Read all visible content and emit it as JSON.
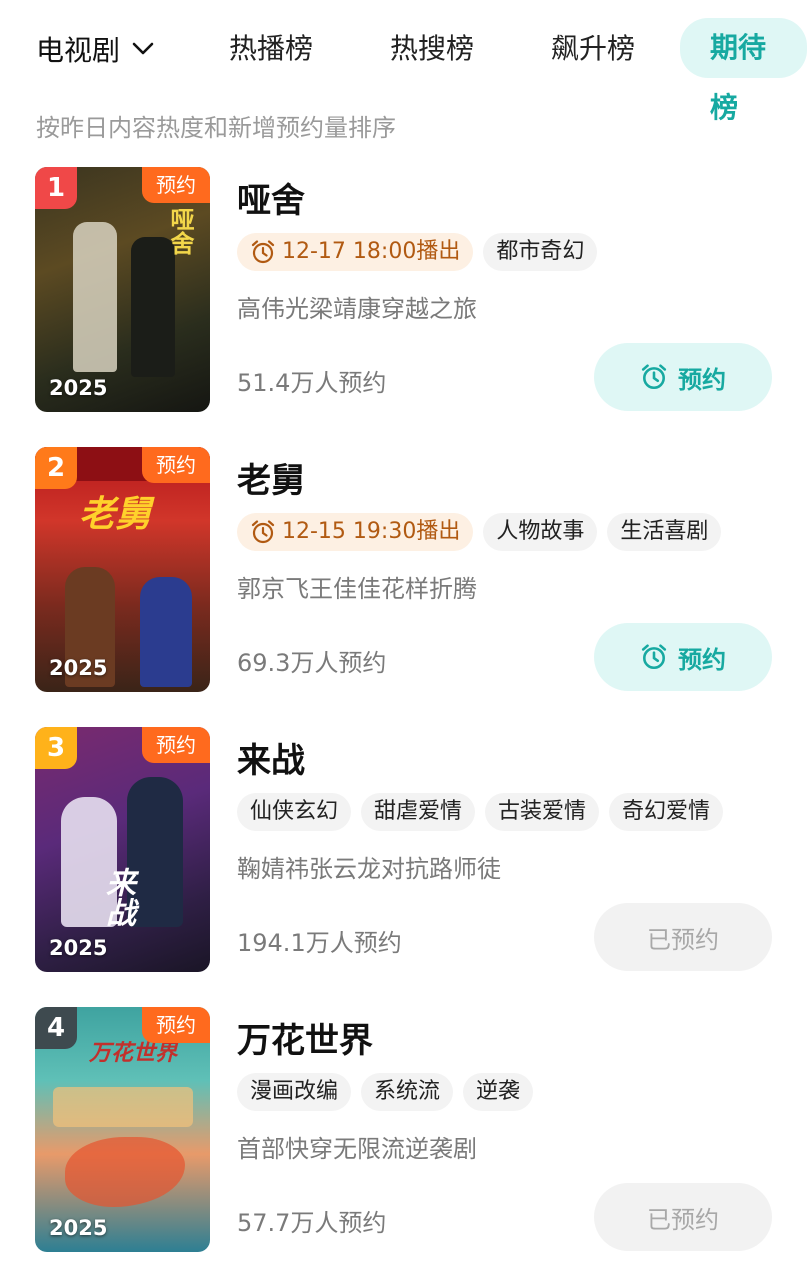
{
  "header": {
    "category": "电视剧",
    "tabs": [
      {
        "label": "热播榜"
      },
      {
        "label": "热搜榜"
      },
      {
        "label": "飙升榜"
      },
      {
        "label": "期待榜"
      }
    ],
    "subtitle": "按昨日内容热度和新增预约量排序"
  },
  "colors": {
    "accent": "#17a9a1",
    "badge": "#ff6a1e",
    "rank1": "#f04848",
    "rank2": "#ff7a1a",
    "rank3": "#ffb21a",
    "rank4": "#3e4a4f"
  },
  "items": [
    {
      "rank": "1",
      "badge": "预约",
      "year": "2025",
      "poster_text": "哑舍",
      "title": "哑舍",
      "air": "12-17 18:00播出",
      "tags": [
        "都市奇幻"
      ],
      "desc": "高伟光梁靖康穿越之旅",
      "count": "51.4万人预约",
      "button": "预约"
    },
    {
      "rank": "2",
      "badge": "预约",
      "year": "2025",
      "poster_text": "老舅",
      "title": "老舅",
      "air": "12-15 19:30播出",
      "tags": [
        "人物故事",
        "生活喜剧"
      ],
      "desc": "郭京飞王佳佳花样折腾",
      "count": "69.3万人预约",
      "button": "预约"
    },
    {
      "rank": "3",
      "badge": "预约",
      "year": "2025",
      "poster_text": "来战",
      "title": "来战",
      "tags": [
        "仙侠玄幻",
        "甜虐爱情",
        "古装爱情",
        "奇幻爱情"
      ],
      "desc": "鞠婧祎张云龙对抗路师徒",
      "count": "194.1万人预约",
      "button": "已预约"
    },
    {
      "rank": "4",
      "badge": "预约",
      "year": "2025",
      "poster_text": "万花世界",
      "title": "万花世界",
      "tags": [
        "漫画改编",
        "系统流",
        "逆袭"
      ],
      "desc": "首部快穿无限流逆袭剧",
      "count": "57.7万人预约",
      "button": "已预约"
    }
  ]
}
